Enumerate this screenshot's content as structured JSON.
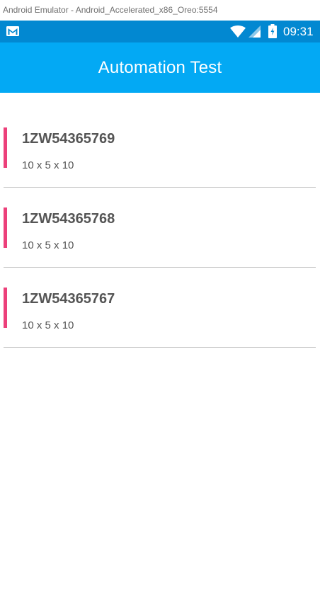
{
  "window": {
    "title": "Android Emulator - Android_Accelerated_x86_Oreo:5554"
  },
  "status_bar": {
    "time": "09:31",
    "icons": [
      "gmail-icon",
      "wifi-icon",
      "signal-icon",
      "battery-icon"
    ],
    "background": "#0288d1"
  },
  "app_bar": {
    "title": "Automation Test",
    "background": "#03a9f4"
  },
  "packages": [
    {
      "tracking": "1ZW54365769",
      "dimensions": "10 x 5 x 10"
    },
    {
      "tracking": "1ZW54365768",
      "dimensions": "10 x 5 x 10"
    },
    {
      "tracking": "1ZW54365767",
      "dimensions": "10 x 5 x 10"
    }
  ],
  "colors": {
    "accent": "#ec407a",
    "text": "#555555",
    "divider": "#c8c8c8"
  }
}
